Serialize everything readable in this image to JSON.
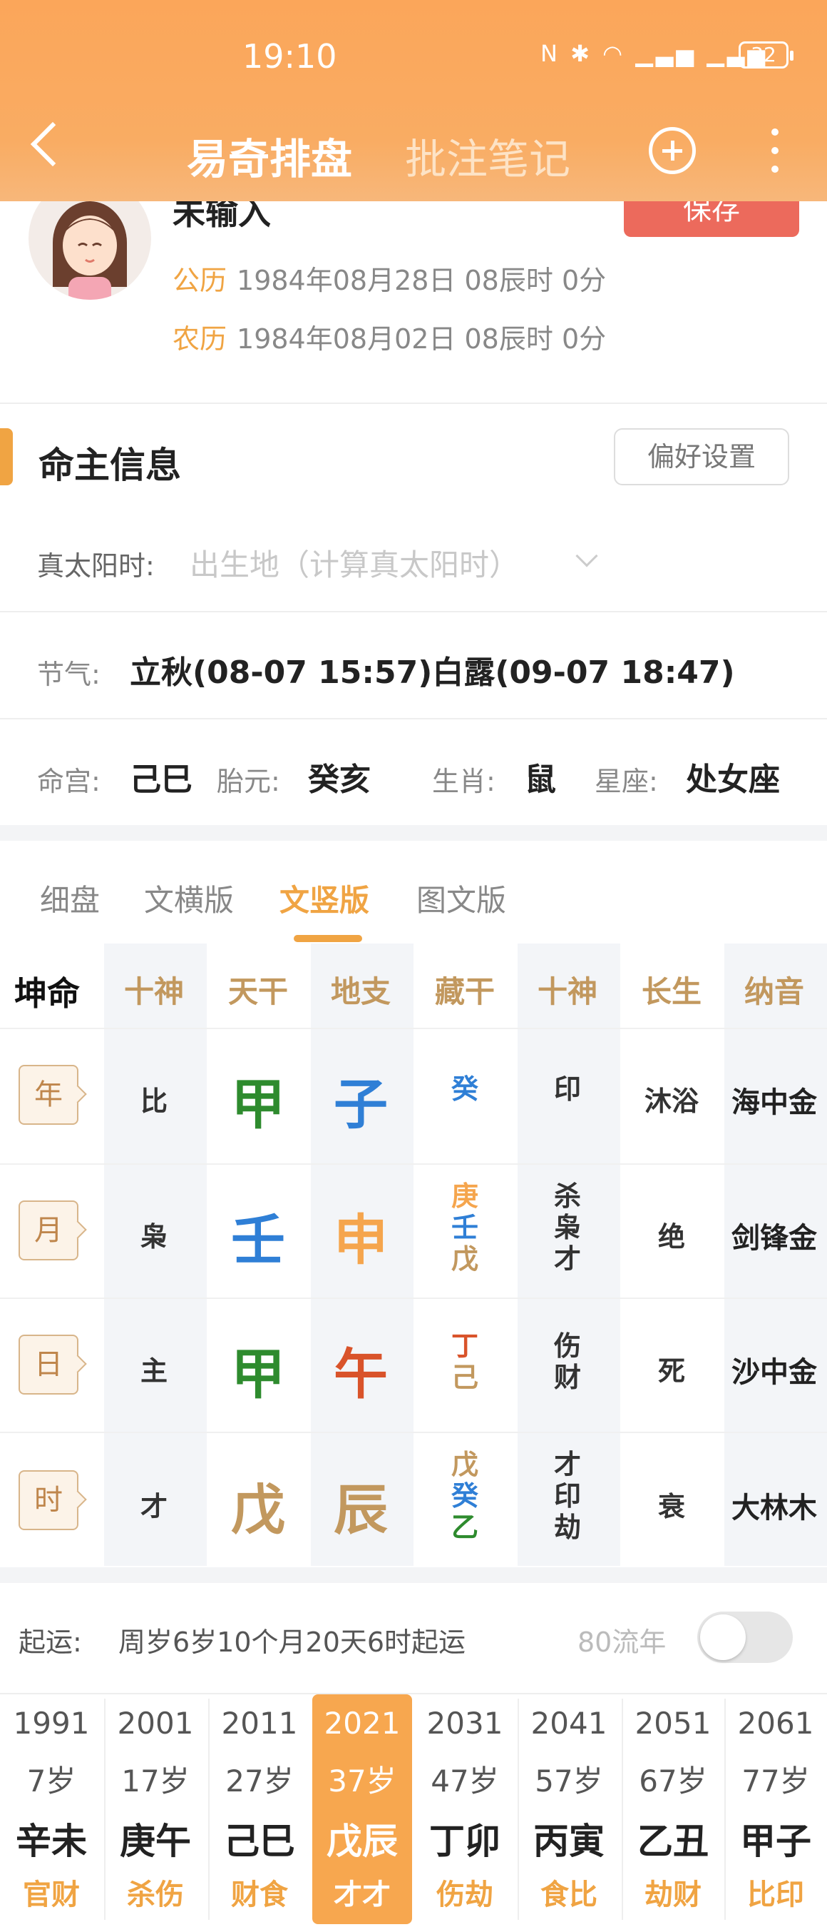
{
  "status_bar": {
    "time": "19:10",
    "battery": "32"
  },
  "header": {
    "tab_active": "易奇排盘",
    "tab_inactive": "批注笔记"
  },
  "profile": {
    "name": "未输入",
    "save_label": "保存",
    "solar_label": "公历",
    "solar_value": "1984年08月28日 08辰时 0分",
    "lunar_label": "农历",
    "lunar_value": "1984年08月02日 08辰时 0分"
  },
  "info": {
    "section_title": "命主信息",
    "pref_button": "偏好设置",
    "true_solar_label": "真太阳时:",
    "true_solar_placeholder": "出生地（计算真太阳时）",
    "jieqi_label": "节气:",
    "jieqi_value": "立秋(08-07 15:57)白露(09-07 18:47)",
    "minggong_label": "命宫:",
    "minggong_value": "己巳",
    "taiyuan_label": "胎元:",
    "taiyuan_value": "癸亥",
    "shengxiao_label": "生肖:",
    "shengxiao_value": "鼠",
    "xingzuo_label": "星座:",
    "xingzuo_value": "处女座"
  },
  "view_tabs": [
    "细盘",
    "文横版",
    "文竖版",
    "图文版"
  ],
  "active_view_tab": "文竖版",
  "chart": {
    "gender": "坤命",
    "headers": [
      "十神",
      "天干",
      "地支",
      "藏干",
      "十神",
      "长生",
      "纳音"
    ],
    "rows": [
      {
        "label": "年",
        "shishen": "比",
        "tiangan": "甲",
        "dizhi": "子",
        "canggan": [
          "癸"
        ],
        "canggan_shishen": [
          "印"
        ],
        "changsheng": "沐浴",
        "nayin": "海中金"
      },
      {
        "label": "月",
        "shishen": "枭",
        "tiangan": "壬",
        "dizhi": "申",
        "canggan": [
          "庚",
          "壬",
          "戊"
        ],
        "canggan_shishen": [
          "杀",
          "枭",
          "才"
        ],
        "changsheng": "绝",
        "nayin": "剑锋金"
      },
      {
        "label": "日",
        "shishen": "主",
        "tiangan": "甲",
        "dizhi": "午",
        "canggan": [
          "丁",
          "己"
        ],
        "canggan_shishen": [
          "伤",
          "财"
        ],
        "changsheng": "死",
        "nayin": "沙中金"
      },
      {
        "label": "时",
        "shishen": "才",
        "tiangan": "戊",
        "dizhi": "辰",
        "canggan": [
          "戊",
          "癸",
          "乙"
        ],
        "canggan_shishen": [
          "才",
          "印",
          "劫"
        ],
        "changsheng": "衰",
        "nayin": "大林木"
      }
    ],
    "element_colors": {
      "wood": "#2e8b2e",
      "water": "#2f7fd6",
      "metal": "#f5a54d",
      "fire": "#d9532a",
      "earth": "#c2985e"
    }
  },
  "qiyun": {
    "label": "起运:",
    "value": "周岁6岁10个月20天6时起运",
    "liunian_label": "80流年",
    "liunian_on": false
  },
  "dayun": [
    {
      "year": "1991",
      "age": "7岁",
      "ganzhi": "辛未",
      "shishen": "官财"
    },
    {
      "year": "2001",
      "age": "17岁",
      "ganzhi": "庚午",
      "shishen": "杀伤"
    },
    {
      "year": "2011",
      "age": "27岁",
      "ganzhi": "己巳",
      "shishen": "财食"
    },
    {
      "year": "2021",
      "age": "37岁",
      "ganzhi": "戊辰",
      "shishen": "才才"
    },
    {
      "year": "2031",
      "age": "47岁",
      "ganzhi": "丁卯",
      "shishen": "伤劫"
    },
    {
      "year": "2041",
      "age": "57岁",
      "ganzhi": "丙寅",
      "shishen": "食比"
    },
    {
      "year": "2051",
      "age": "67岁",
      "ganzhi": "乙丑",
      "shishen": "劫财"
    },
    {
      "year": "2061",
      "age": "77岁",
      "ganzhi": "甲子",
      "shishen": "比印"
    }
  ],
  "dayun_selected": "2021"
}
